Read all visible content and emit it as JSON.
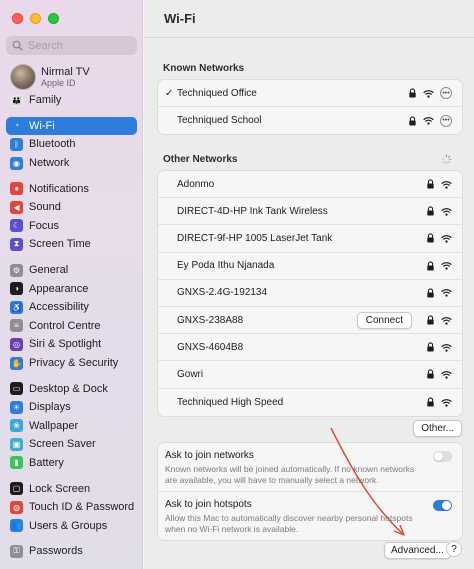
{
  "window": {
    "title": "Wi-Fi"
  },
  "sidebar": {
    "search_placeholder": "Search",
    "profile": {
      "name": "Nirmal TV",
      "subtitle": "Apple ID"
    },
    "groups": [
      [
        {
          "label": "Family",
          "icon": "family-icon",
          "color": "#e6e6e6",
          "glyph": "👪"
        }
      ],
      [
        {
          "label": "Wi-Fi",
          "icon": "wifi-icon",
          "color": "#2f7ddb",
          "glyph": "◔",
          "selected": true
        },
        {
          "label": "Bluetooth",
          "icon": "bluetooth-icon",
          "color": "#2f7ddb",
          "glyph": "ᛒ"
        },
        {
          "label": "Network",
          "icon": "globe-icon",
          "color": "#2f7ddb",
          "glyph": "◉"
        }
      ],
      [
        {
          "label": "Notifications",
          "icon": "bell-icon",
          "color": "#e3453b",
          "glyph": "●"
        },
        {
          "label": "Sound",
          "icon": "speaker-icon",
          "color": "#e3453b",
          "glyph": "◀"
        },
        {
          "label": "Focus",
          "icon": "moon-icon",
          "color": "#5a4fcf",
          "glyph": "☾"
        },
        {
          "label": "Screen Time",
          "icon": "hourglass-icon",
          "color": "#5a4fcf",
          "glyph": "⧗"
        }
      ],
      [
        {
          "label": "General",
          "icon": "gear-icon",
          "color": "#8e8e93",
          "glyph": "⚙"
        },
        {
          "label": "Appearance",
          "icon": "appearance-icon",
          "color": "#1d1d1f",
          "glyph": "◑"
        },
        {
          "label": "Accessibility",
          "icon": "accessibility-icon",
          "color": "#2f7ddb",
          "glyph": "♿"
        },
        {
          "label": "Control Centre",
          "icon": "control-centre-icon",
          "color": "#8e8e93",
          "glyph": "≡"
        },
        {
          "label": "Siri & Spotlight",
          "icon": "siri-icon",
          "color": "#6a3fb5",
          "glyph": "◎"
        },
        {
          "label": "Privacy & Security",
          "icon": "hand-icon",
          "color": "#2f7ddb",
          "glyph": "✋"
        }
      ],
      [
        {
          "label": "Desktop & Dock",
          "icon": "dock-icon",
          "color": "#1d1d1f",
          "glyph": "▭"
        },
        {
          "label": "Displays",
          "icon": "display-icon",
          "color": "#2f7ddb",
          "glyph": "☀"
        },
        {
          "label": "Wallpaper",
          "icon": "wallpaper-icon",
          "color": "#39a8e0",
          "glyph": "❀"
        },
        {
          "label": "Screen Saver",
          "icon": "screen-saver-icon",
          "color": "#3fb0c9",
          "glyph": "▣"
        },
        {
          "label": "Battery",
          "icon": "battery-icon",
          "color": "#34c759",
          "glyph": "▮"
        }
      ],
      [
        {
          "label": "Lock Screen",
          "icon": "lock-screen-icon",
          "color": "#1d1d1f",
          "glyph": "▢"
        },
        {
          "label": "Touch ID & Password",
          "icon": "fingerprint-icon",
          "color": "#e3453b",
          "glyph": "◍"
        },
        {
          "label": "Users & Groups",
          "icon": "users-icon",
          "color": "#2f7ddb",
          "glyph": "👥"
        }
      ],
      [
        {
          "label": "Passwords",
          "icon": "key-icon",
          "color": "#8e8e93",
          "glyph": "⚿"
        }
      ]
    ]
  },
  "known_networks": {
    "heading": "Known Networks",
    "items": [
      {
        "name": "Techniqued Office",
        "connected": true
      },
      {
        "name": "Techniqued School",
        "connected": false
      }
    ]
  },
  "other_networks": {
    "heading": "Other Networks",
    "items": [
      {
        "name": "Adonmo",
        "locked": true
      },
      {
        "name": "DIRECT-4D-HP Ink Tank Wireless",
        "locked": true
      },
      {
        "name": "DIRECT-9f-HP 1005 LaserJet Tank",
        "locked": true
      },
      {
        "name": "Ey Poda Ithu Njanada",
        "locked": true
      },
      {
        "name": "GNXS-2.4G-192134",
        "locked": true
      },
      {
        "name": "GNXS-238A88",
        "locked": true,
        "connect_button": "Connect"
      },
      {
        "name": "GNXS-4604B8",
        "locked": true
      },
      {
        "name": "Gowri",
        "locked": true
      },
      {
        "name": "Techniqued High Speed",
        "locked": true
      }
    ],
    "other_button": "Other..."
  },
  "settings": {
    "ask_networks": {
      "title": "Ask to join networks",
      "description": "Known networks will be joined automatically. If no known networks are available, you will have to manually select a network.",
      "enabled": false
    },
    "ask_hotspots": {
      "title": "Ask to join hotspots",
      "description": "Allow this Mac to automatically discover nearby personal hotspots when no Wi-Fi network is available.",
      "enabled": true
    }
  },
  "footer": {
    "advanced_button": "Advanced...",
    "help_button": "?"
  },
  "colors": {
    "accent": "#2f7ddb",
    "annotation_arrow": "#d9482b"
  }
}
